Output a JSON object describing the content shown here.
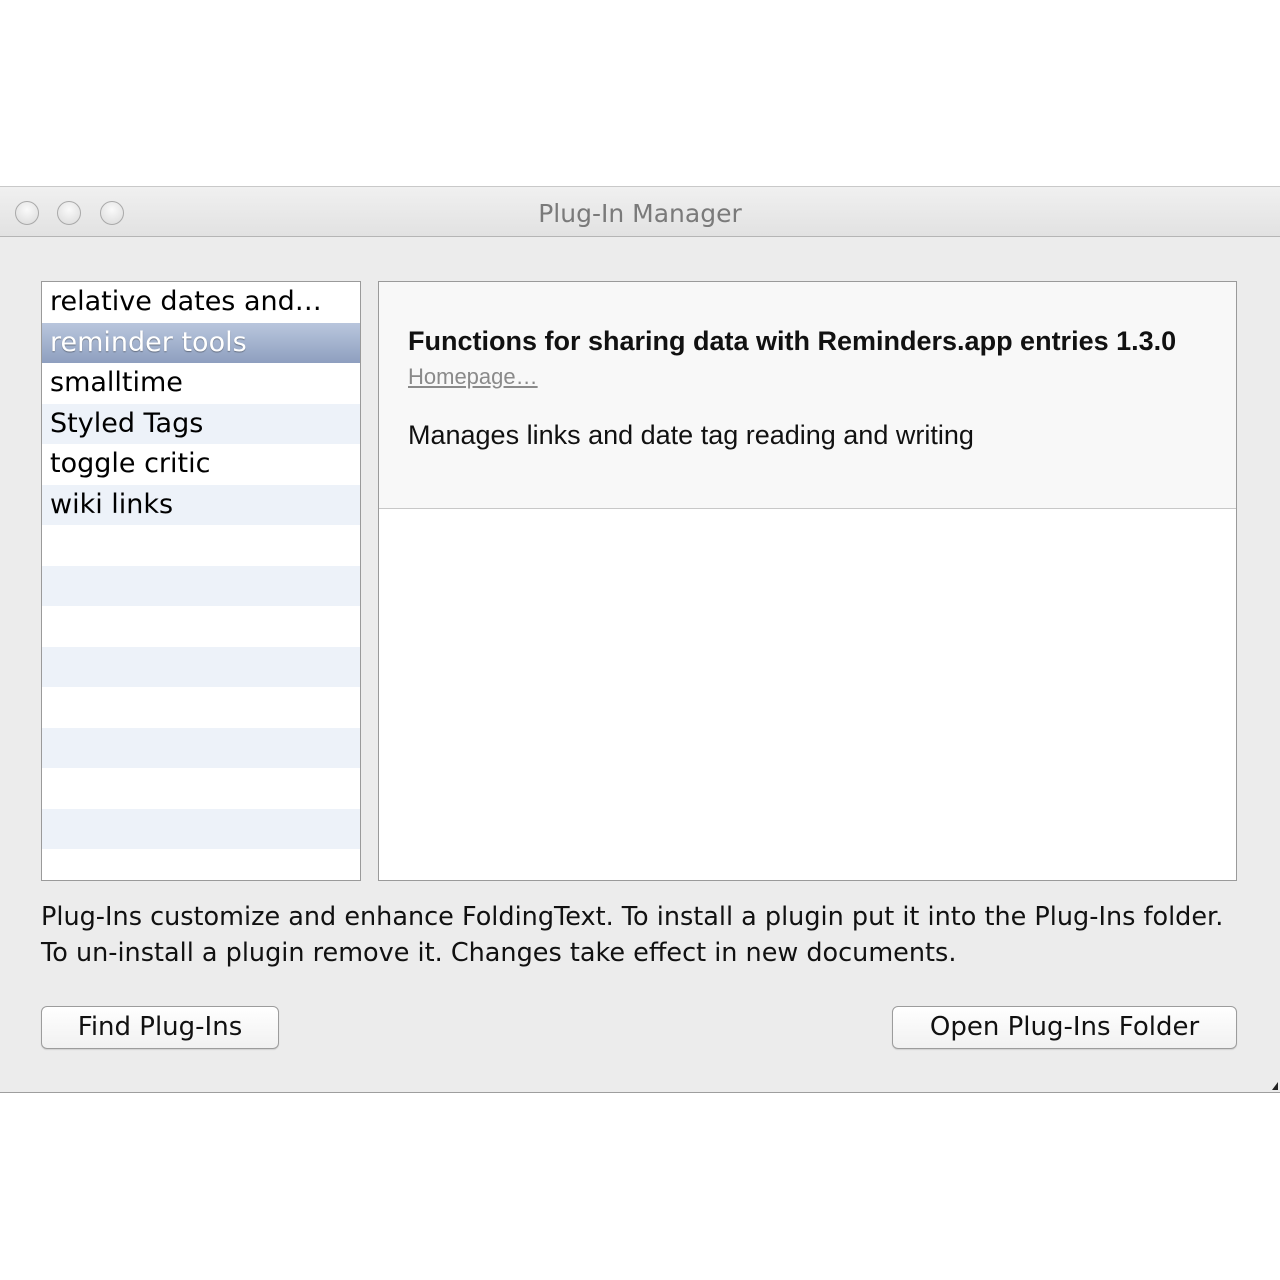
{
  "window": {
    "title": "Plug-In Manager"
  },
  "plugin_list": {
    "items": [
      {
        "label": "relative dates and…",
        "selected": false
      },
      {
        "label": "reminder tools",
        "selected": true
      },
      {
        "label": "smalltime",
        "selected": false
      },
      {
        "label": "Styled Tags",
        "selected": false
      },
      {
        "label": "toggle critic",
        "selected": false
      },
      {
        "label": "wiki links",
        "selected": false
      }
    ]
  },
  "detail": {
    "title": "Functions for sharing data with Reminders.app entries 1.3.0",
    "homepage_label": "Homepage…",
    "description": "Manages links and date tag reading and writing"
  },
  "info_text": "Plug-Ins customize and enhance FoldingText. To install a plugin put it into the Plug-Ins folder. To un-install a plugin remove it. Changes take effect in new documents.",
  "buttons": {
    "find_label": "Find Plug-Ins",
    "open_folder_label": "Open Plug-Ins Folder"
  },
  "colors": {
    "selection": "#9aa9c6",
    "alt_row": "#edf2f9",
    "window_bg": "#ececec"
  }
}
